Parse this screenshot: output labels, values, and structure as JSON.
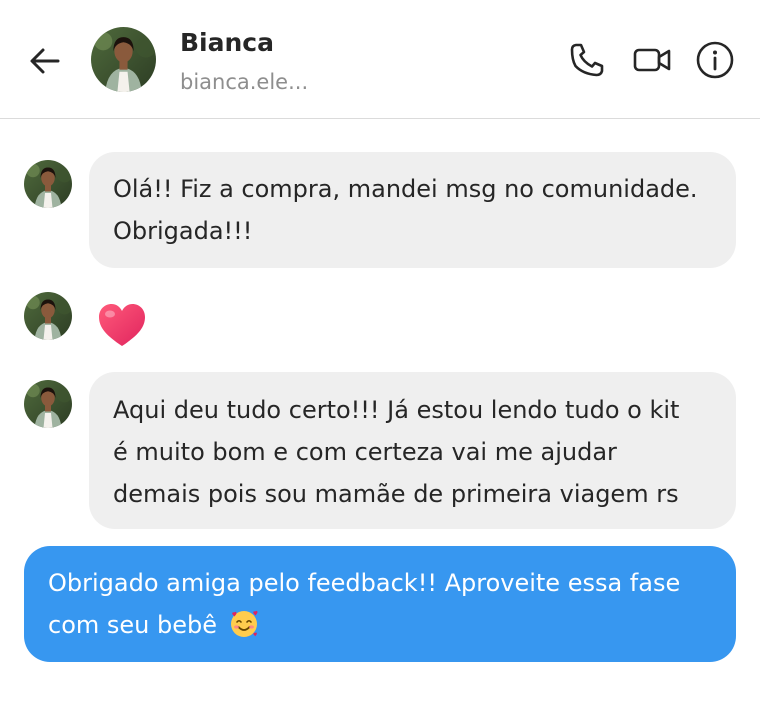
{
  "header": {
    "name": "Bianca",
    "handle": "bianca.ele..."
  },
  "messages": [
    {
      "direction": "incoming",
      "lines": [
        "Olá!! Fiz a compra, mandei msg no comunidade.",
        "Obrigada!!!"
      ]
    },
    {
      "direction": "incoming",
      "type": "reaction",
      "icon": "heart-emoji"
    },
    {
      "direction": "incoming",
      "lines": [
        "Aqui deu tudo certo!!! Já estou lendo tudo o kit",
        "é muito bom e com certeza vai me ajudar",
        "demais pois sou mamãe de primeira viagem rs"
      ]
    },
    {
      "direction": "outgoing",
      "lines": [
        "Obrigado amiga pelo feedback!! Aproveite essa fase",
        "com seu bebê"
      ],
      "trailing_icon": "smiling-face-with-hearts-emoji"
    }
  ],
  "colors": {
    "outgoing_bubble": "#3797f0",
    "incoming_bubble": "#efefef",
    "divider": "#dbdbdb",
    "secondary_text": "#8e8e8e"
  }
}
